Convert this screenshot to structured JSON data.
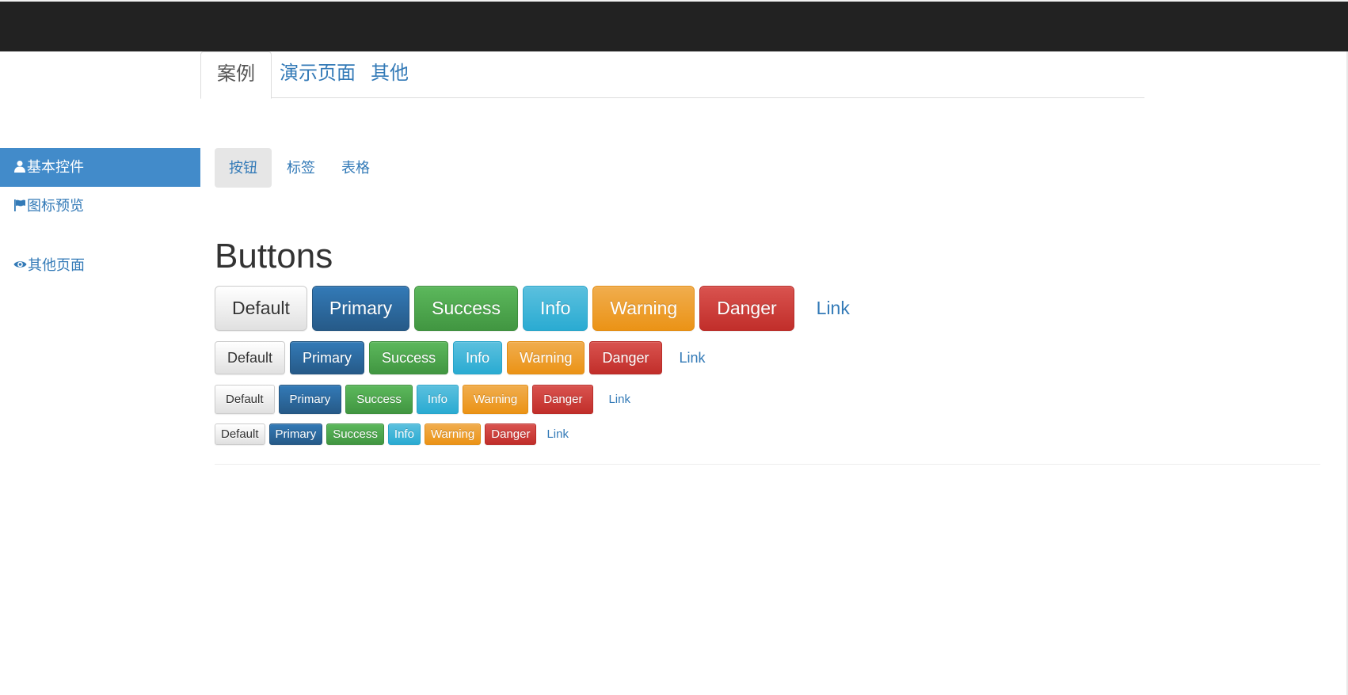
{
  "top_tabs": [
    {
      "label": "案例",
      "active": true
    },
    {
      "label": "演示页面",
      "active": false
    },
    {
      "label": "其他",
      "active": false
    }
  ],
  "sidebar": {
    "items": [
      {
        "label": "基本控件",
        "icon": "user-icon",
        "active": true
      },
      {
        "label": "图标预览",
        "icon": "flag-icon",
        "active": false
      },
      {
        "label": "其他页面",
        "icon": "eye-icon",
        "active": false
      }
    ]
  },
  "pills": [
    {
      "label": "按钮",
      "active": true
    },
    {
      "label": "标签",
      "active": false
    },
    {
      "label": "表格",
      "active": false
    }
  ],
  "main": {
    "heading": "Buttons"
  },
  "buttons": {
    "default": "Default",
    "primary": "Primary",
    "success": "Success",
    "info": "Info",
    "warning": "Warning",
    "danger": "Danger",
    "link": "Link"
  },
  "colors": {
    "navbar": "#222222",
    "sidebar_active": "#428bca",
    "link": "#337ab7",
    "primary": "#337ab7",
    "success": "#5cb85c",
    "info": "#5bc0de",
    "warning": "#f0ad4e",
    "danger": "#d9534f"
  }
}
